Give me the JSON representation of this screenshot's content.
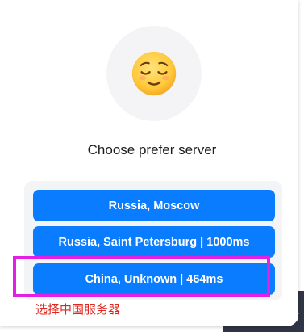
{
  "dialog": {
    "emoji_icon": "relieved-face-emoji",
    "title": "Choose prefer server"
  },
  "servers": [
    {
      "label": "Russia, Moscow"
    },
    {
      "label": "Russia, Saint Petersburg | 1000ms"
    },
    {
      "label": "China, Unknown | 464ms"
    }
  ],
  "annotation": {
    "text": "选择中国服务器",
    "highlight_color": "#e51ee6",
    "text_color": "#e0261e"
  },
  "colors": {
    "accent": "#0a7cff",
    "panel": "#f3f4f6"
  }
}
